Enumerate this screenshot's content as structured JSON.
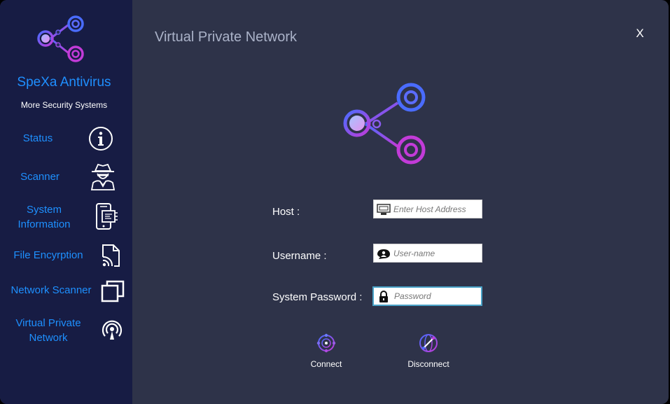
{
  "app": {
    "brand_name": "SpeXa Antivirus",
    "brand_tagline": "More Security Systems",
    "accent": "#1e90ff",
    "sidebar_bg": "#171c44",
    "main_bg": "#2e3349"
  },
  "sidebar": {
    "items": [
      {
        "label": "Status",
        "icon": "info-icon"
      },
      {
        "label": "Scanner",
        "icon": "spy-agent-icon"
      },
      {
        "label": "System Information",
        "icon": "chip-phone-icon"
      },
      {
        "label": "File Encyrption",
        "icon": "file-signal-icon"
      },
      {
        "label": "Network Scanner",
        "icon": "windows-stack-icon"
      },
      {
        "label": "Virtual Private Network",
        "icon": "broadcast-icon"
      }
    ]
  },
  "main": {
    "title": "Virtual Private Network",
    "close_label": "X",
    "form": {
      "host": {
        "label": "Host :",
        "placeholder": "Enter Host Address",
        "value": "",
        "icon": "monitor-icon"
      },
      "username": {
        "label": "Username :",
        "placeholder": "User-name",
        "value": "",
        "icon": "user-speech-icon"
      },
      "password": {
        "label": "System Password :",
        "placeholder": "Password",
        "value": "",
        "icon": "lock-icon"
      }
    },
    "actions": {
      "connect": {
        "label": "Connect",
        "icon": "connect-globe-icon"
      },
      "disconnect": {
        "label": "Disconnect",
        "icon": "disconnect-globe-icon"
      }
    }
  }
}
